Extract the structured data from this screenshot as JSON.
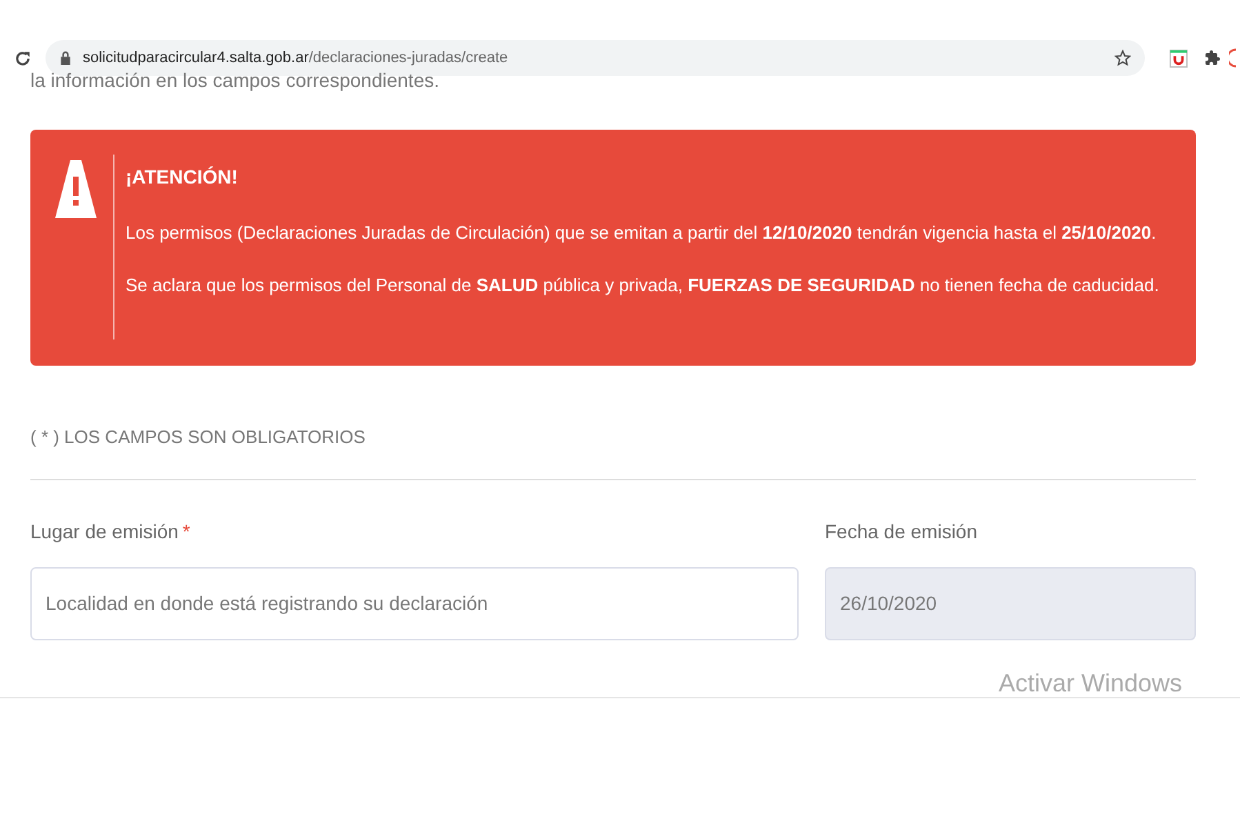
{
  "browser": {
    "url": "**solicitudparacircular4.salta.gob.ar**/declaraciones-juradas/create"
  },
  "intro_text": "la información en los campos correspondientes.",
  "alert": {
    "title": "¡ATENCIÓN!",
    "lines": [
      "Los permisos (Declaraciones Juradas de Circulación) que se emitan a partir del **12/10/2020** tendrán vigencia hasta el **25/10/2020**.",
      "Se aclara que los permisos del Personal de **SALUD** pública y privada, **FUERZAS DE SEGURIDAD** no tienen fecha de caducidad."
    ]
  },
  "required_note": "( * ) LOS CAMPOS SON OBLIGATORIOS",
  "fields": [
    {
      "label": "Lugar de emisión",
      "required_mark": "*",
      "placeholder": "Localidad en donde está registrando su declaración",
      "disabled": false
    },
    {
      "label": "Fecha de emisión",
      "value": "26/10/2020",
      "disabled": true
    }
  ],
  "os_overlay": "Activar Windows"
}
